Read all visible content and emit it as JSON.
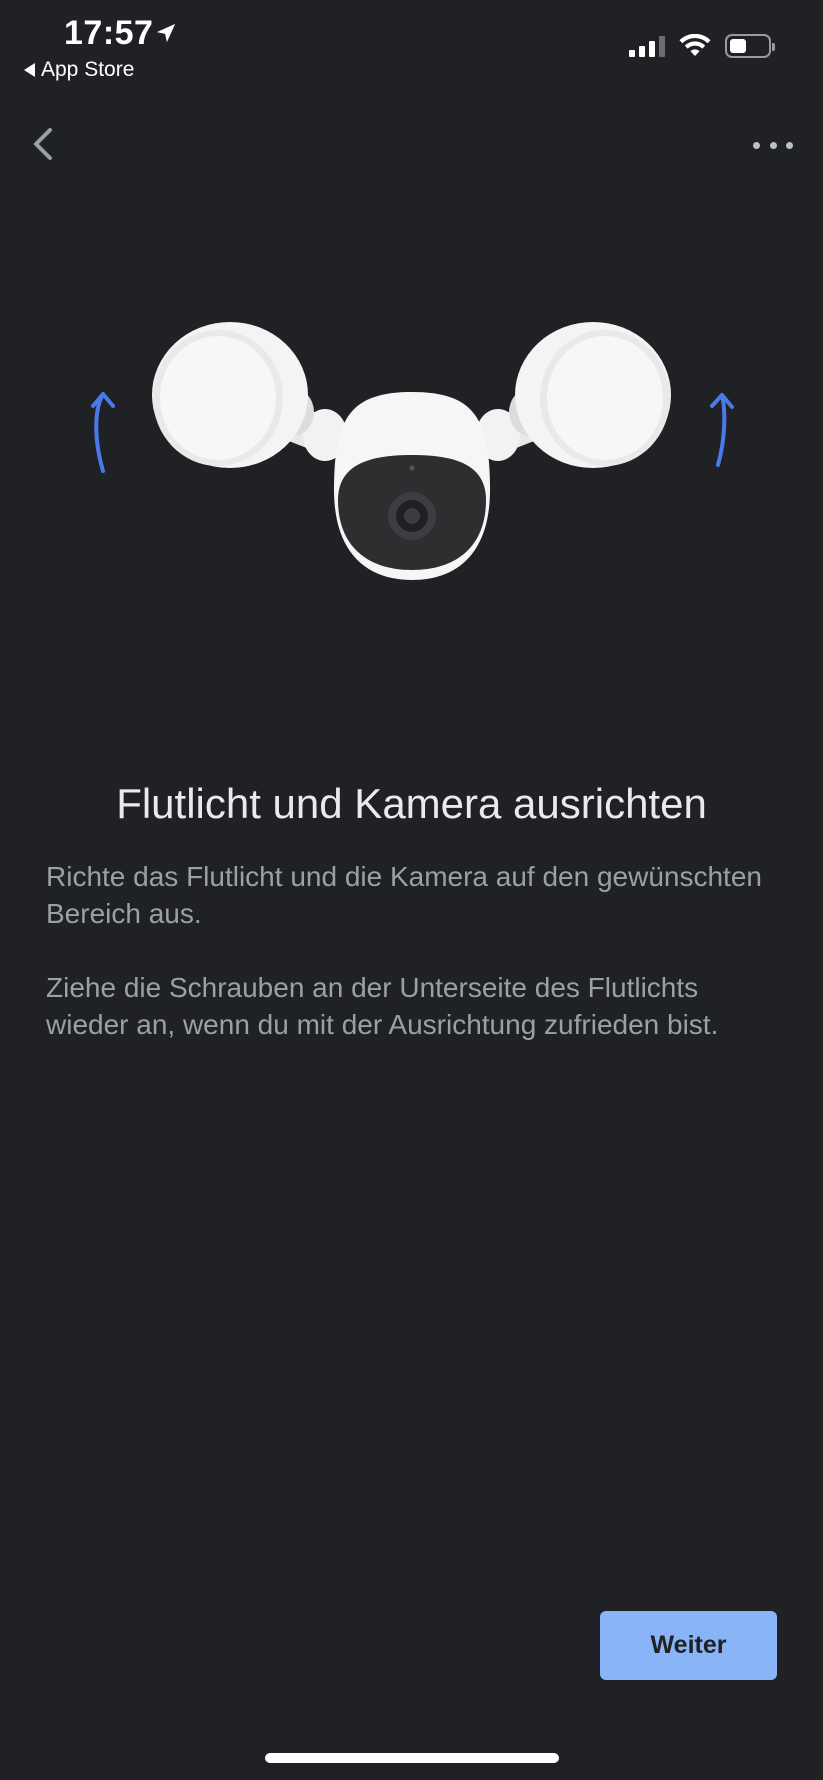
{
  "status_bar": {
    "time": "17:57",
    "back_to_app": "App Store"
  },
  "header": {
    "back_icon": "chevron-left-icon",
    "more_icon": "more-horizontal-icon"
  },
  "illustration": {
    "subject": "floodlight-camera",
    "arrow_color": "#4a7ae8"
  },
  "content": {
    "title": "Flutlicht und Kamera ausrichten",
    "paragraph_1": "Richte das Flutlicht und die Kamera auf den gewünschten Bereich aus.",
    "paragraph_2": "Ziehe die Schrauben an der Unterseite des Flutlichts wieder an, wenn du mit der Ausrichtung zufrieden bist."
  },
  "footer": {
    "next_label": "Weiter"
  },
  "colors": {
    "background": "#202124",
    "accent": "#8ab4f8",
    "title_text": "#e8eaed",
    "body_text": "#9aa0a6"
  }
}
